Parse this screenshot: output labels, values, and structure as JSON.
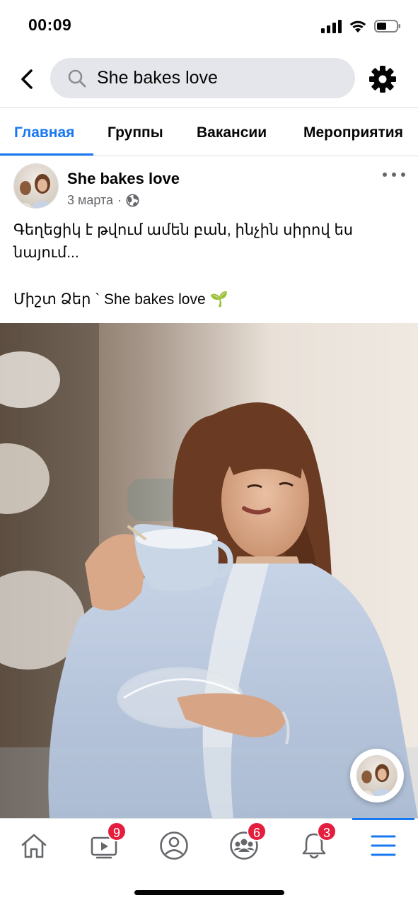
{
  "status_bar": {
    "time": "00:09"
  },
  "search": {
    "value": "She bakes love"
  },
  "tabs": [
    {
      "label": "Главная",
      "active": true
    },
    {
      "label": "Группы",
      "active": false
    },
    {
      "label": "Вакансии",
      "active": false
    },
    {
      "label": "Мероприятия",
      "active": false
    }
  ],
  "post": {
    "author": "She bakes love",
    "date": "3 марта",
    "separator": "·",
    "text_line1": "Գեղեցիկ է թվում ամեն բան, ինչին սիրով ես նայում...",
    "text_line2": "Միշտ Ձեր ` She bakes love 🌱"
  },
  "bottom_nav": {
    "watch_badge": "9",
    "groups_badge": "6",
    "notifications_badge": "3"
  },
  "colors": {
    "accent": "#1877f2",
    "badge": "#e41e3f",
    "secondary_text": "#65676b"
  }
}
